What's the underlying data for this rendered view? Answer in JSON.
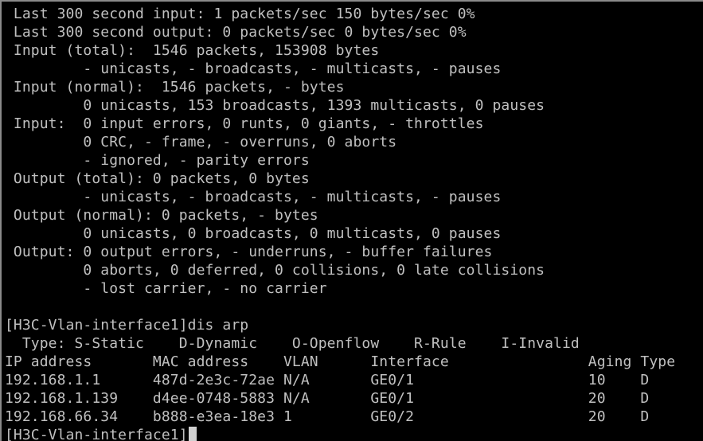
{
  "terminal": {
    "lines": [
      " Last 300 second input: 1 packets/sec 150 bytes/sec 0%",
      " Last 300 second output: 0 packets/sec 0 bytes/sec 0%",
      " Input (total):  1546 packets, 153908 bytes",
      "         - unicasts, - broadcasts, - multicasts, - pauses",
      " Input (normal):  1546 packets, - bytes",
      "         0 unicasts, 153 broadcasts, 1393 multicasts, 0 pauses",
      " Input:  0 input errors, 0 runts, 0 giants, - throttles",
      "         0 CRC, - frame, - overruns, 0 aborts",
      "         - ignored, - parity errors",
      " Output (total): 0 packets, 0 bytes",
      "         - unicasts, - broadcasts, - multicasts, - pauses",
      " Output (normal): 0 packets, - bytes",
      "         0 unicasts, 0 broadcasts, 0 multicasts, 0 pauses",
      " Output: 0 output errors, - underruns, - buffer failures",
      "         0 aborts, 0 deferred, 0 collisions, 0 late collisions",
      "         - lost carrier, - no carrier",
      "",
      "[H3C-Vlan-interface1]dis arp",
      "  Type: S-Static    D-Dynamic    O-Openflow    R-Rule    I-Invalid",
      "IP address       MAC address    VLAN      Interface                Aging Type",
      "192.168.1.1      487d-2e3c-72ae N/A       GE0/1                    10    D",
      "192.168.1.139    d4ee-0748-5883 N/A       GE0/1                    20    D",
      "192.168.66.34    b888-e3ea-18e3 1         GE0/2                    20    D"
    ],
    "prompt": "[H3C-Vlan-interface1]",
    "prompt_input": "",
    "colors": {
      "background": "#000000",
      "foreground": "#c0c0c0",
      "cursor": "#d0d0d0"
    }
  }
}
